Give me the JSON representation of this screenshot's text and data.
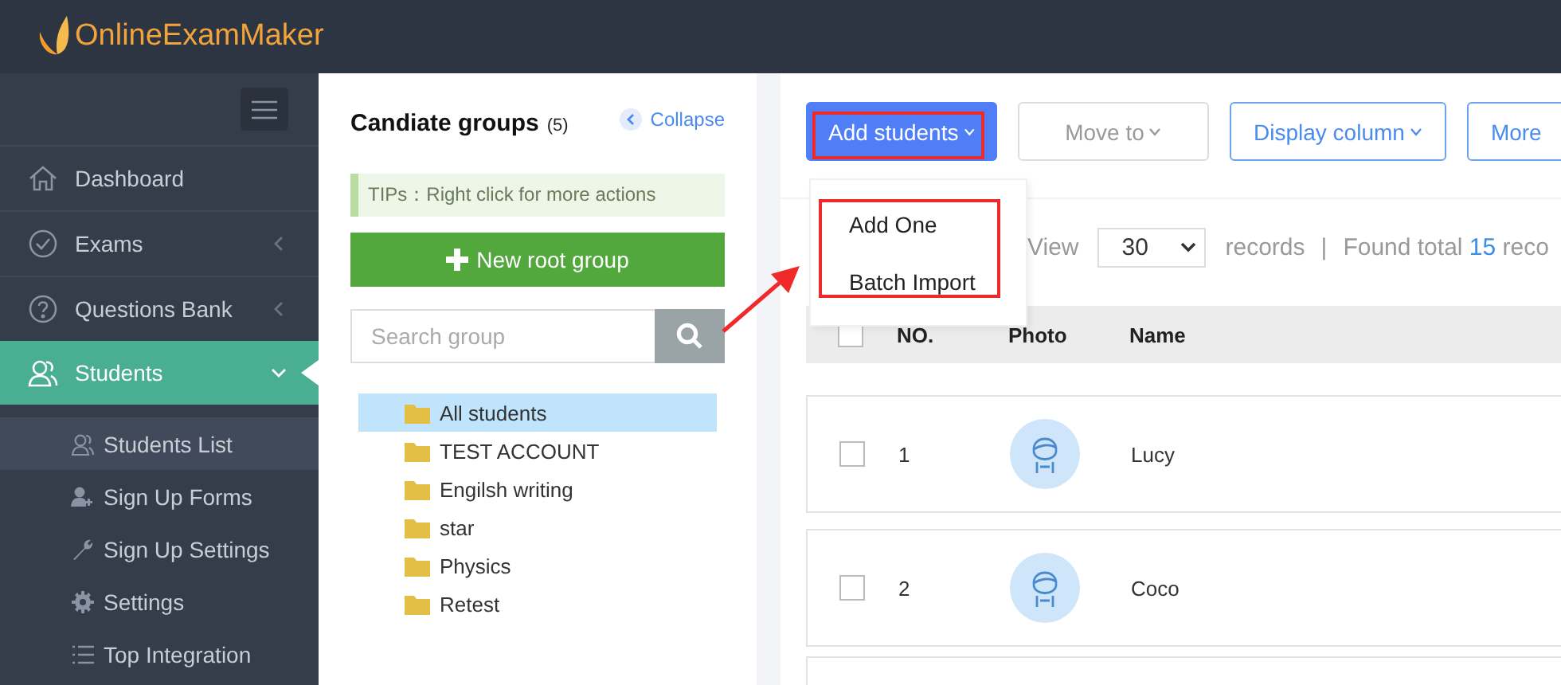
{
  "brand": {
    "name": "OnlineExamMaker"
  },
  "sidebar": {
    "items": [
      {
        "label": "Dashboard",
        "kind": "link",
        "selected": false
      },
      {
        "label": "Exams",
        "kind": "menu",
        "expanded": false,
        "selected": false
      },
      {
        "label": "Questions Bank",
        "kind": "menu",
        "expanded": false,
        "selected": false
      },
      {
        "label": "Students",
        "kind": "menu",
        "expanded": true,
        "selected": true,
        "children": [
          {
            "label": "Students List",
            "selected": true
          },
          {
            "label": "Sign Up Forms",
            "selected": false
          },
          {
            "label": "Sign Up Settings",
            "selected": false
          },
          {
            "label": "Settings",
            "selected": false
          },
          {
            "label": "Top Integration",
            "selected": false
          }
        ]
      }
    ]
  },
  "groups": {
    "title": "Candiate groups",
    "count": "(5)",
    "collapse": "Collapse",
    "tip": "TIPs：Right click for more actions",
    "new_button": "New root group",
    "search": {
      "placeholder": "Search group"
    },
    "tree": [
      {
        "label": "All students",
        "selected": true
      },
      {
        "label": "TEST ACCOUNT",
        "selected": false
      },
      {
        "label": "Engilsh writing",
        "selected": false
      },
      {
        "label": "star",
        "selected": false
      },
      {
        "label": "Physics",
        "selected": false
      },
      {
        "label": "Retest",
        "selected": false
      }
    ]
  },
  "toolbar": [
    {
      "label": "Add students",
      "kind": "primary"
    },
    {
      "label": "Move to",
      "kind": "default"
    },
    {
      "label": "Display column",
      "kind": "outline"
    },
    {
      "label": "More",
      "kind": "outline"
    }
  ],
  "dropdown": [
    "Add One",
    "Batch Import"
  ],
  "paging": {
    "view": "View",
    "page_size": "30",
    "records": "records",
    "separator": "|",
    "found": "Found total",
    "total": "15",
    "rest": "reco"
  },
  "table": {
    "header_checked": false,
    "columns": [
      "NO.",
      "Photo",
      "Name"
    ],
    "rows": [
      {
        "no": "1",
        "name": "Lucy",
        "checked": false
      },
      {
        "no": "2",
        "name": "Coco",
        "checked": false
      }
    ]
  }
}
